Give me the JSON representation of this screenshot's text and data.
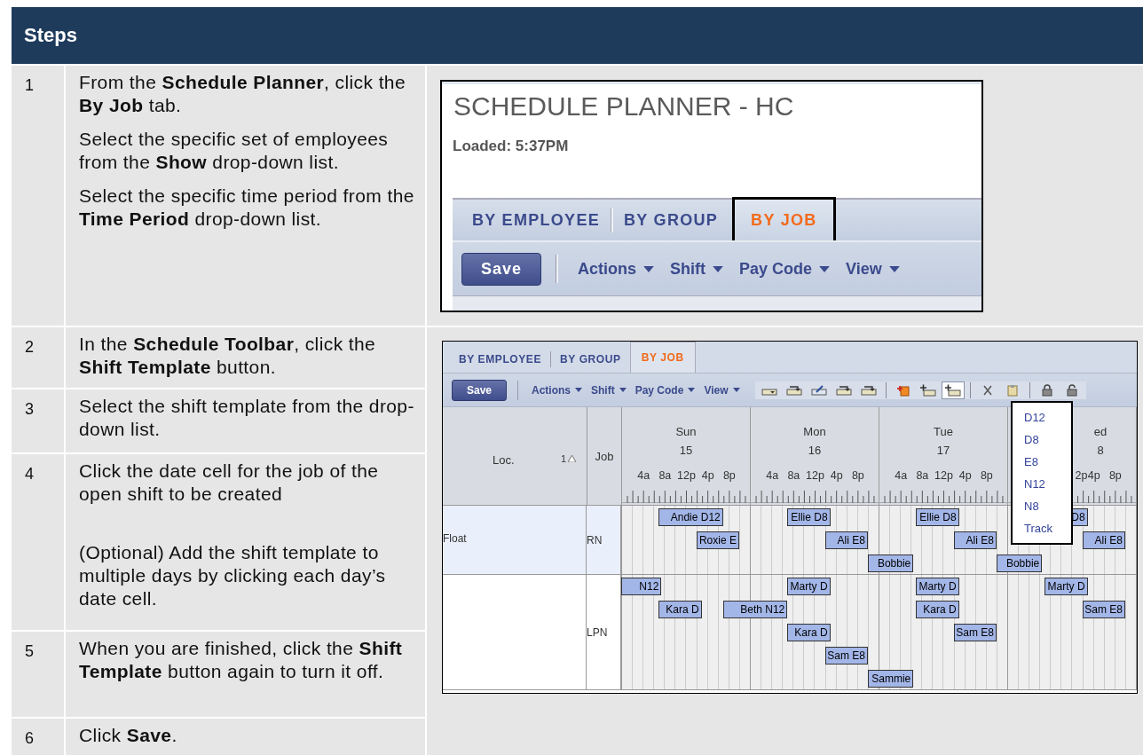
{
  "header": {
    "title": "Steps"
  },
  "steps": [
    {
      "number": "1",
      "paragraphs": [
        "From the **Schedule Planner**, click the **By Job** tab.",
        "Select the specific set of employees from the **Show** drop-down list.",
        "Select the specific time period from the **Time Period** drop-down list."
      ]
    },
    {
      "number": "2",
      "paragraphs": [
        "In the **Schedule Toolbar**, click the **Shift Template** button."
      ]
    },
    {
      "number": "3",
      "paragraphs": [
        "Select the shift template from the drop-down list."
      ]
    },
    {
      "number": "4",
      "paragraphs": [
        "Click the date cell for the job of the open shift to be created",
        "(Optional) Add the shift template to multiple days by clicking each day’s date cell."
      ]
    },
    {
      "number": "5",
      "paragraphs": [
        "When you are finished, click the **Shift Template** button again to turn it off."
      ]
    },
    {
      "number": "6",
      "paragraphs": [
        "Click **Save**."
      ]
    }
  ],
  "planner_header": {
    "title": "SCHEDULE PLANNER - HC",
    "loaded": "Loaded: 5:37PM",
    "tabs": [
      {
        "label": "BY EMPLOYEE",
        "selected": false,
        "callout": false
      },
      {
        "label": "BY GROUP",
        "selected": false,
        "callout": false
      },
      {
        "label": "BY JOB",
        "selected": true,
        "callout": true
      }
    ],
    "toolbar": {
      "save": "Save",
      "menus": [
        "Actions",
        "Shift",
        "Pay Code",
        "View"
      ]
    }
  },
  "planner_grid": {
    "tabs": [
      {
        "label": "BY EMPLOYEE",
        "selected": false
      },
      {
        "label": "BY GROUP",
        "selected": false
      },
      {
        "label": "BY JOB",
        "selected": true
      }
    ],
    "toolbar": {
      "save": "Save",
      "menus": [
        "Actions",
        "Shift",
        "Pay Code",
        "View"
      ],
      "icons": [
        {
          "kind": "tray",
          "pressed": false
        },
        {
          "kind": "tray-arrow",
          "pressed": false
        },
        {
          "kind": "tray-pencil",
          "pressed": false
        },
        {
          "kind": "tray-arrow",
          "pressed": false
        },
        {
          "kind": "tray-arrow",
          "pressed": false
        },
        {
          "kind": "separator"
        },
        {
          "kind": "add-document",
          "pressed": false
        },
        {
          "kind": "add-tray",
          "pressed": false
        },
        {
          "kind": "add-tray",
          "pressed": true
        },
        {
          "kind": "separator"
        },
        {
          "kind": "close",
          "pressed": false
        },
        {
          "kind": "clipboard",
          "pressed": false
        },
        {
          "kind": "separator"
        },
        {
          "kind": "lock",
          "pressed": false
        },
        {
          "kind": "unlock",
          "pressed": false
        }
      ]
    },
    "template_menu": {
      "items": [
        "D12",
        "D8",
        "E8",
        "N12",
        "N8",
        "Track"
      ]
    },
    "columns": {
      "location": "Loc.",
      "sort": "1",
      "job": "Job"
    },
    "days": [
      {
        "name": "Sun",
        "date": "15",
        "times": [
          "4a",
          "8a",
          "12p",
          "4p",
          "8p"
        ],
        "kind": "full"
      },
      {
        "name": "Mon",
        "date": "16",
        "times": [
          "4a",
          "8a",
          "12p",
          "4p",
          "8p"
        ],
        "kind": "full"
      },
      {
        "name": "Tue",
        "date": "17",
        "times": [
          "4a",
          "8a",
          "12p",
          "4p",
          "8p"
        ],
        "kind": "full"
      },
      {
        "name": "ed",
        "date": "8",
        "times": [
          "2p",
          "4p",
          "8p"
        ],
        "kind": "partial"
      }
    ],
    "groups": [
      {
        "location": "Float",
        "job": "RN",
        "selected": true,
        "lanes": [
          [
            {
              "label": "Andie D12",
              "kind": "sun-day-12"
            },
            {
              "label": "Ellie D8",
              "kind": "mon-day-8"
            },
            {
              "label": "Ellie D8",
              "kind": "tue-day-8"
            },
            {
              "label": "D8",
              "kind": "wed-day-8"
            }
          ],
          [
            {
              "label": "Roxie E",
              "kind": "sun-evening-8"
            },
            {
              "label": "Ali E8",
              "kind": "mon-evening-8"
            },
            {
              "label": "Ali E8",
              "kind": "tue-evening-8"
            },
            {
              "label": "Ali E8",
              "kind": "wed-evening-8"
            }
          ],
          [
            {
              "label": "Bobbie",
              "kind": "mon-overnight-8"
            },
            {
              "label": "Bobbie",
              "kind": "tue-overnight-8"
            }
          ]
        ]
      },
      {
        "job": "LPN",
        "selected": false,
        "lanes": [
          [
            {
              "label": "N12",
              "kind": "sun-night-end"
            },
            {
              "label": "Marty D",
              "kind": "mon-day-8"
            },
            {
              "label": "Marty D",
              "kind": "tue-day-8"
            },
            {
              "label": "Marty D",
              "kind": "wed-day-8"
            }
          ],
          [
            {
              "label": "Kara D",
              "kind": "sun-day-8"
            },
            {
              "label": "Beth N12",
              "kind": "sun-night-12"
            },
            {
              "label": "Kara D",
              "kind": "tue-day-8"
            },
            {
              "label": "Sam E8",
              "kind": "wed-evening-8"
            }
          ],
          [
            {
              "label": "Kara D",
              "kind": "mon-day-8"
            },
            {
              "label": "Sam E8",
              "kind": "tue-evening-8"
            }
          ],
          [
            {
              "label": "Sam E8",
              "kind": "mon-evening-8"
            }
          ],
          [
            {
              "label": "Sammie",
              "kind": "mon-overnight-8"
            }
          ]
        ]
      }
    ]
  }
}
